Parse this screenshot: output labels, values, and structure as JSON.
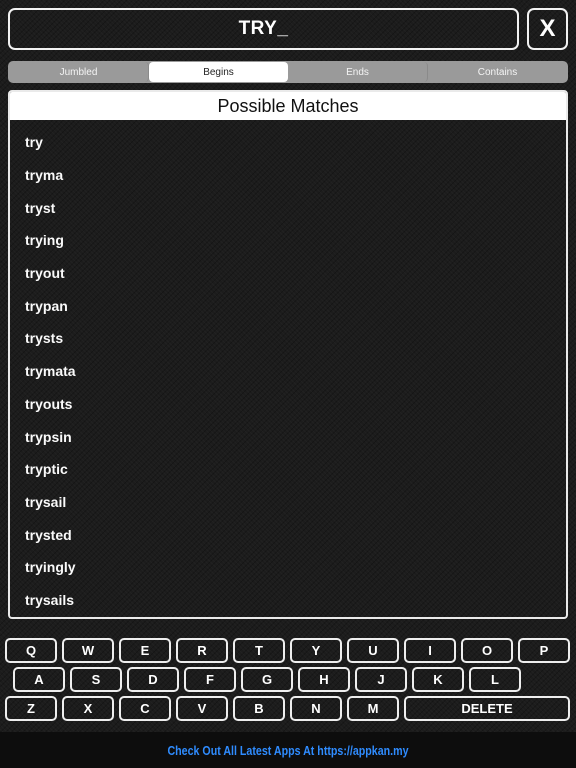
{
  "input": {
    "value": "TRY_"
  },
  "close_label": "X",
  "tabs": [
    {
      "label": "Jumbled",
      "active": false
    },
    {
      "label": "Begins",
      "active": true
    },
    {
      "label": "Ends",
      "active": false
    },
    {
      "label": "Contains",
      "active": false
    }
  ],
  "results": {
    "title": "Possible Matches",
    "items": [
      "try",
      "tryma",
      "tryst",
      "trying",
      "tryout",
      "trypan",
      "trysts",
      "trymata",
      "tryouts",
      "trypsin",
      "tryptic",
      "trysail",
      "trysted",
      "tryingly",
      "trysails"
    ]
  },
  "keyboard": {
    "row1": [
      "Q",
      "W",
      "E",
      "R",
      "T",
      "Y",
      "U",
      "I",
      "O",
      "P"
    ],
    "row2": [
      "A",
      "S",
      "D",
      "F",
      "G",
      "H",
      "J",
      "K",
      "L"
    ],
    "row3": [
      "Z",
      "X",
      "C",
      "V",
      "B",
      "N",
      "M"
    ],
    "delete_label": "DELETE"
  },
  "footer": {
    "text": "Check Out All Latest Apps At https://appkan.my"
  },
  "colors": {
    "background": "#1c1c1c",
    "border": "#f2f2f2",
    "link": "#2f8cff",
    "segment": "#9a9a9a"
  }
}
